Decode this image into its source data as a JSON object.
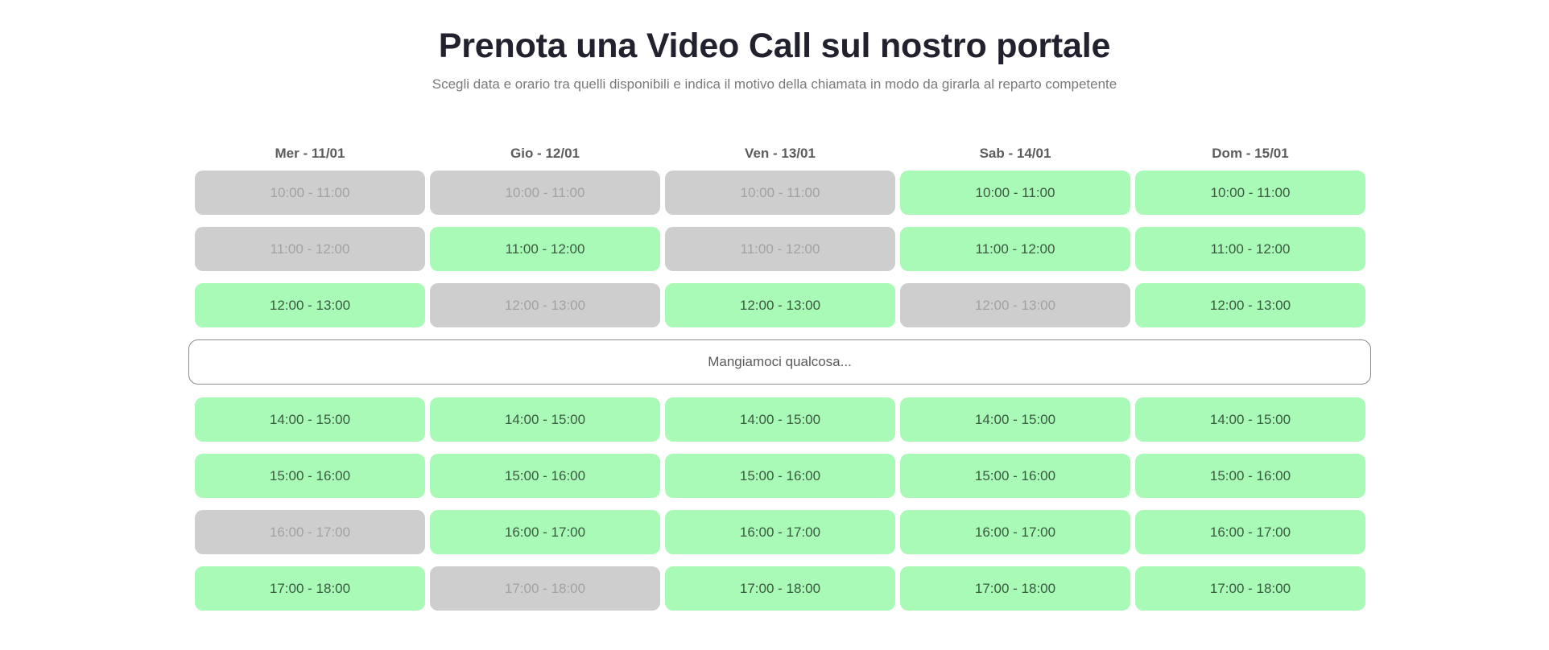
{
  "header": {
    "title": "Prenota una Video Call sul nostro portale",
    "subtitle": "Scegli data e orario tra quelli disponibili e indica il motivo della chiamata in modo da girarla al reparto competente"
  },
  "colors": {
    "available": "#a9f9b7",
    "unavailable": "#cecece"
  },
  "days": [
    "Mer - 11/01",
    "Gio - 12/01",
    "Ven - 13/01",
    "Sab - 14/01",
    "Dom - 15/01"
  ],
  "lunch_break": "Mangiamoci qualcosa...",
  "morning": [
    {
      "time": "10:00 - 11:00",
      "available": [
        false,
        false,
        false,
        true,
        true
      ]
    },
    {
      "time": "11:00 - 12:00",
      "available": [
        false,
        true,
        false,
        true,
        true
      ]
    },
    {
      "time": "12:00 - 13:00",
      "available": [
        true,
        false,
        true,
        false,
        true
      ]
    }
  ],
  "afternoon": [
    {
      "time": "14:00 - 15:00",
      "available": [
        true,
        true,
        true,
        true,
        true
      ]
    },
    {
      "time": "15:00 - 16:00",
      "available": [
        true,
        true,
        true,
        true,
        true
      ]
    },
    {
      "time": "16:00 - 17:00",
      "available": [
        false,
        true,
        true,
        true,
        true
      ]
    },
    {
      "time": "17:00 - 18:00",
      "available": [
        true,
        false,
        true,
        true,
        true
      ]
    }
  ]
}
